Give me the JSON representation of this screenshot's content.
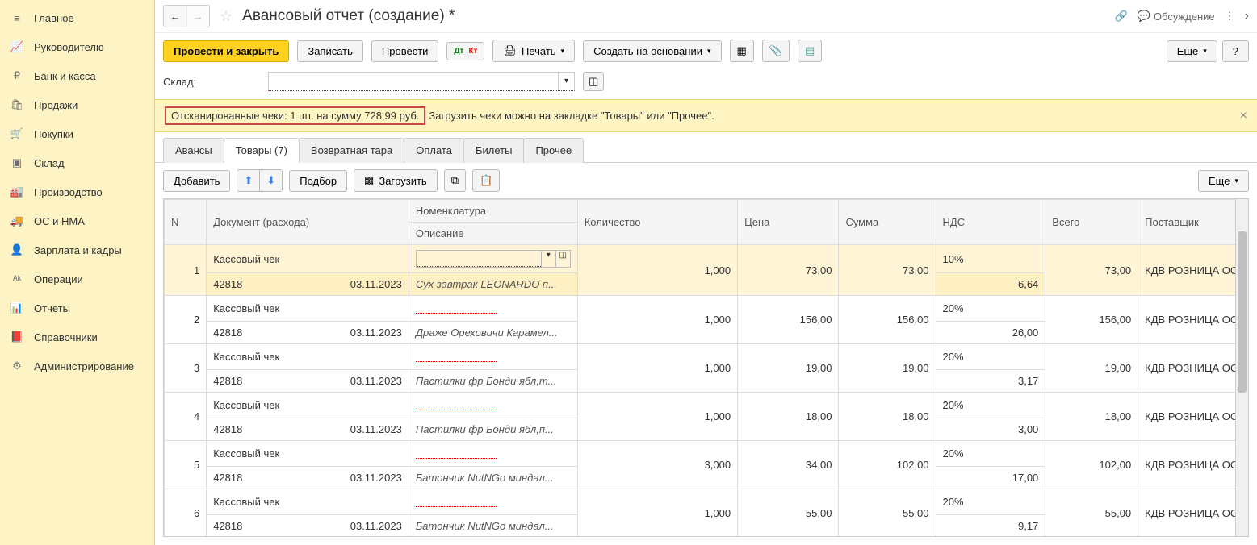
{
  "sidebar": {
    "items": [
      {
        "icon": "menu",
        "label": "Главное"
      },
      {
        "icon": "chart",
        "label": "Руководителю"
      },
      {
        "icon": "ruble",
        "label": "Банк и касса"
      },
      {
        "icon": "bag",
        "label": "Продажи"
      },
      {
        "icon": "cart",
        "label": "Покупки"
      },
      {
        "icon": "boxes",
        "label": "Склад"
      },
      {
        "icon": "factory",
        "label": "Производство"
      },
      {
        "icon": "truck",
        "label": "ОС и НМА"
      },
      {
        "icon": "person",
        "label": "Зарплата и кадры"
      },
      {
        "icon": "dtkt",
        "label": "Операции"
      },
      {
        "icon": "bars",
        "label": "Отчеты"
      },
      {
        "icon": "book",
        "label": "Справочники"
      },
      {
        "icon": "gear",
        "label": "Администрирование"
      }
    ]
  },
  "header": {
    "title": "Авансовый отчет (создание) *",
    "discuss": "Обсуждение"
  },
  "toolbar": {
    "post_close": "Провести и закрыть",
    "save": "Записать",
    "post": "Провести",
    "print": "Печать",
    "create_based": "Создать на основании",
    "more": "Еще",
    "help": "?"
  },
  "fields": {
    "warehouse_label": "Склад:"
  },
  "banner": {
    "highlighted": "Отсканированные чеки: 1 шт. на сумму 728,99 руб.",
    "rest": "Загрузить чеки можно на закладке \"Товары\" или \"Прочее\"."
  },
  "tabs": [
    {
      "label": "Авансы",
      "active": false
    },
    {
      "label": "Товары (7)",
      "active": true
    },
    {
      "label": "Возвратная тара",
      "active": false
    },
    {
      "label": "Оплата",
      "active": false
    },
    {
      "label": "Билеты",
      "active": false
    },
    {
      "label": "Прочее",
      "active": false
    }
  ],
  "subtoolbar": {
    "add": "Добавить",
    "pick": "Подбор",
    "load": "Загрузить",
    "more": "Еще"
  },
  "table": {
    "headers": {
      "n": "N",
      "doc": "Документ (расхода)",
      "nomen": "Номенклатура",
      "desc": "Описание",
      "qty": "Количество",
      "price": "Цена",
      "sum": "Сумма",
      "vat": "НДС",
      "total": "Всего",
      "supplier": "Поставщик"
    },
    "rows": [
      {
        "n": "1",
        "doc": "Кассовый чек",
        "docnum": "42818",
        "docdate": "03.11.2023",
        "nomen": "",
        "desc": "Сух завтрак LEONARDO п...",
        "qty": "1,000",
        "price": "73,00",
        "sum": "73,00",
        "vat": "10%",
        "vatsum": "6,64",
        "total": "73,00",
        "supplier": "КДВ РОЗНИЦА ОС",
        "selected": true
      },
      {
        "n": "2",
        "doc": "Кассовый чек",
        "docnum": "42818",
        "docdate": "03.11.2023",
        "nomen": "",
        "desc": "Драже Ореховичи Карамел...",
        "qty": "1,000",
        "price": "156,00",
        "sum": "156,00",
        "vat": "20%",
        "vatsum": "26,00",
        "total": "156,00",
        "supplier": "КДВ РОЗНИЦА ОС"
      },
      {
        "n": "3",
        "doc": "Кассовый чек",
        "docnum": "42818",
        "docdate": "03.11.2023",
        "nomen": "",
        "desc": "Пастилки фр Бонди ябл,т...",
        "qty": "1,000",
        "price": "19,00",
        "sum": "19,00",
        "vat": "20%",
        "vatsum": "3,17",
        "total": "19,00",
        "supplier": "КДВ РОЗНИЦА ОС"
      },
      {
        "n": "4",
        "doc": "Кассовый чек",
        "docnum": "42818",
        "docdate": "03.11.2023",
        "nomen": "",
        "desc": "Пастилки фр Бонди ябл,п...",
        "qty": "1,000",
        "price": "18,00",
        "sum": "18,00",
        "vat": "20%",
        "vatsum": "3,00",
        "total": "18,00",
        "supplier": "КДВ РОЗНИЦА ОС"
      },
      {
        "n": "5",
        "doc": "Кассовый чек",
        "docnum": "42818",
        "docdate": "03.11.2023",
        "nomen": "",
        "desc": "Батончик NutNGo миндал...",
        "qty": "3,000",
        "price": "34,00",
        "sum": "102,00",
        "vat": "20%",
        "vatsum": "17,00",
        "total": "102,00",
        "supplier": "КДВ РОЗНИЦА ОС"
      },
      {
        "n": "6",
        "doc": "Кассовый чек",
        "docnum": "42818",
        "docdate": "03.11.2023",
        "nomen": "",
        "desc": "Батончик NutNGo миндал...",
        "qty": "1,000",
        "price": "55,00",
        "sum": "55,00",
        "vat": "20%",
        "vatsum": "9,17",
        "total": "55,00",
        "supplier": "КДВ РОЗНИЦА ОС"
      }
    ]
  }
}
